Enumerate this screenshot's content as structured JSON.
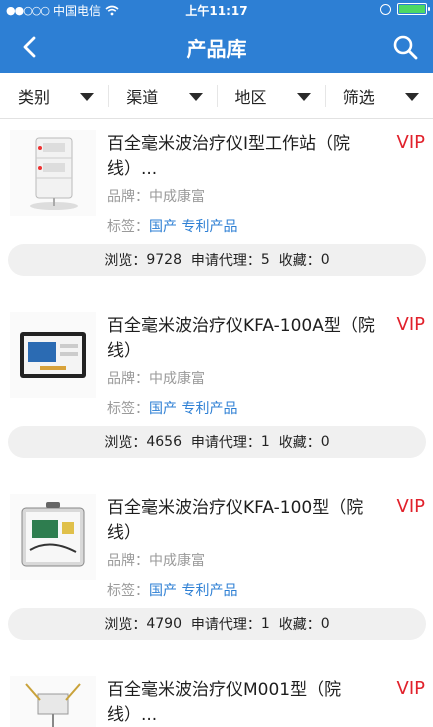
{
  "status_bar": {
    "signal": "●●○○○",
    "carrier": "中国电信",
    "time": "上午11:17"
  },
  "nav": {
    "title": "产品库"
  },
  "filters": [
    {
      "label": "类别"
    },
    {
      "label": "渠道"
    },
    {
      "label": "地区"
    },
    {
      "label": "筛选"
    }
  ],
  "labels": {
    "brand_prefix": "品牌：",
    "tags_prefix": "标签：",
    "views_prefix": "浏览：",
    "agent_prefix": "申请代理：",
    "fav_prefix": "收藏："
  },
  "products": [
    {
      "name": "百全毫米波治疗仪I型工作站（院线）...",
      "vip": "VIP",
      "brand": "中成康富",
      "tags": [
        "国产",
        "专利产品"
      ],
      "views": "9728",
      "agent_requests": "5",
      "favorites": "0",
      "image_icon": "workstation-device-icon"
    },
    {
      "name": "百全毫米波治疗仪KFA-100A型（院线）",
      "vip": "VIP",
      "brand": "中成康富",
      "tags": [
        "国产",
        "专利产品"
      ],
      "views": "4656",
      "agent_requests": "1",
      "favorites": "0",
      "image_icon": "case-device-icon"
    },
    {
      "name": "百全毫米波治疗仪KFA-100型（院线）",
      "vip": "VIP",
      "brand": "中成康富",
      "tags": [
        "国产",
        "专利产品"
      ],
      "views": "4790",
      "agent_requests": "1",
      "favorites": "0",
      "image_icon": "case-device-icon"
    },
    {
      "name": "百全毫米波治疗仪M001型（院线）...",
      "vip": "VIP",
      "brand": "",
      "tags": [],
      "views": "",
      "agent_requests": "",
      "favorites": "",
      "image_icon": "stand-device-icon"
    }
  ],
  "colors": {
    "primary": "#2d7fd4",
    "vip": "#e1212b",
    "tag": "#2d7fd4",
    "stats_bg": "#f0f0f0"
  }
}
